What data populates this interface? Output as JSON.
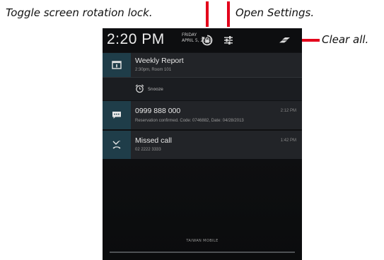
{
  "callouts": {
    "rotation_lock": "Toggle screen rotation lock.",
    "settings": "Open Settings.",
    "clear_all": "Clear all."
  },
  "colors": {
    "pointer": "#e3001b",
    "icon_box": "#1f3d49",
    "notification_bg": "#222428"
  },
  "status_header": {
    "time": "2:20 PM",
    "day": "FRIDAY",
    "date": "APRIL 5, 2013",
    "icons": [
      "rotation-lock-icon",
      "settings-icon",
      "clear-all-icon"
    ]
  },
  "notifications": [
    {
      "icon": "calendar-icon",
      "title": "Weekly Report",
      "subtitle": "2:30pm, Room 101",
      "action": {
        "icon": "alarm-clock-icon",
        "label": "Snooze"
      }
    },
    {
      "icon": "message-icon",
      "title": "0999 888 000",
      "subtitle": "Reservation confirmed. Code: 0746882, Date: 04/28/2013",
      "time": "2:12 PM"
    },
    {
      "icon": "missed-call-icon",
      "title": "Missed call",
      "subtitle": "02 2222 3333",
      "time": "1:42 PM"
    }
  ],
  "carrier": "TAIWAN MOBILE"
}
